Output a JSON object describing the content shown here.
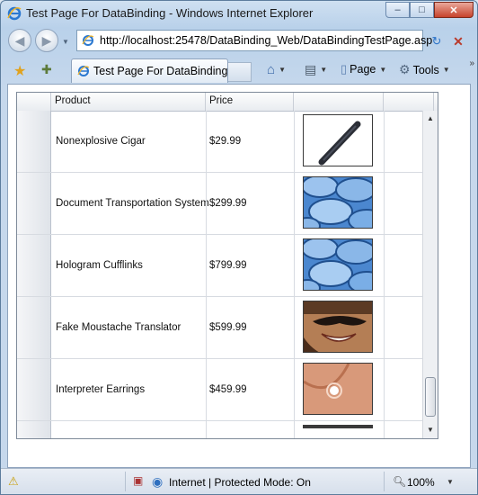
{
  "window": {
    "title": "Test Page For DataBinding - Windows Internet Explorer",
    "minimize_glyph": "–",
    "maximize_glyph": "□",
    "close_glyph": "✕"
  },
  "navigation": {
    "back_icon": "back-arrow-icon",
    "forward_icon": "forward-arrow-icon",
    "address": "http://localhost:25478/DataBinding_Web/DataBindingTestPage.asp",
    "refresh_icon": "refresh-icon",
    "stop_icon": "stop-icon"
  },
  "commandbar": {
    "tab_label": "Test Page For DataBinding",
    "page_label": "Page",
    "tools_label": "Tools",
    "more_glyph": "»"
  },
  "grid": {
    "columns": [
      "Product",
      "Price"
    ],
    "rows": [
      {
        "product": "Nonexplosive Cigar",
        "price": "$29.99",
        "image": "cigar"
      },
      {
        "product": "Document Transportation System",
        "price": "$299.99",
        "image": "blue-discs"
      },
      {
        "product": "Hologram Cufflinks",
        "price": "$799.99",
        "image": "blue-discs"
      },
      {
        "product": "Fake Moustache Translator",
        "price": "$599.99",
        "image": "moustache"
      },
      {
        "product": "Interpreter Earrings",
        "price": "$459.99",
        "image": "earring"
      }
    ]
  },
  "statusbar": {
    "zone": "Internet | Protected Mode: On",
    "zoom": "100%"
  },
  "colors": {
    "chrome": "#c6d8ec",
    "grid_border": "#7e8a99",
    "close_button": "#c7432c"
  }
}
